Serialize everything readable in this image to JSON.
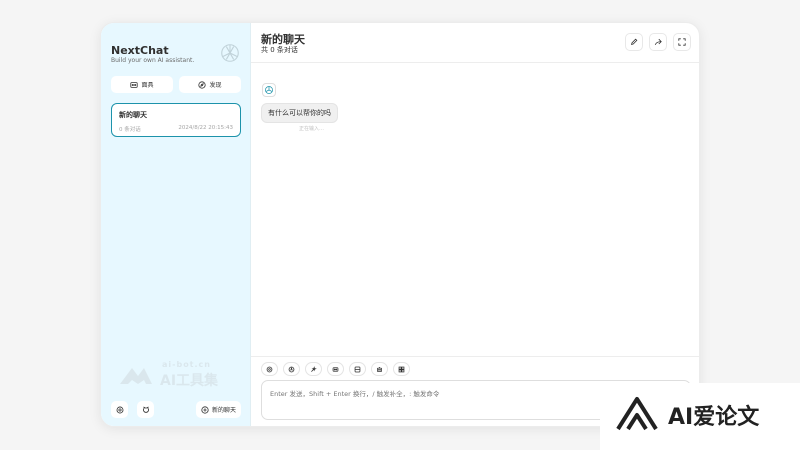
{
  "sidebar": {
    "brand_title": "NextChat",
    "brand_subtitle": "Build your own AI assistant.",
    "mask_label": "面具",
    "plugin_label": "发现",
    "chat_item": {
      "title": "新的聊天",
      "count": "0 条对话",
      "time": "2024/8/22 20:15:43"
    },
    "watermark_domain": "ai-bot.cn",
    "watermark_text": "AI工具集",
    "new_chat_label": "新的聊天"
  },
  "header": {
    "title": "新的聊天",
    "subtitle": "共 0 条对话"
  },
  "messages": [
    {
      "role": "assistant",
      "text": "有什么可以帮你的吗",
      "meta": "正在输入…"
    }
  ],
  "input": {
    "placeholder": "Enter 发送，Shift + Enter 换行，/ 触发补全，: 触发命令"
  },
  "corner_badge": {
    "text": "AI爱论文"
  },
  "colors": {
    "sidebar_bg": "#e7f8ff",
    "accent": "#1d93ab",
    "bubble_bg": "#f0f0f0"
  }
}
